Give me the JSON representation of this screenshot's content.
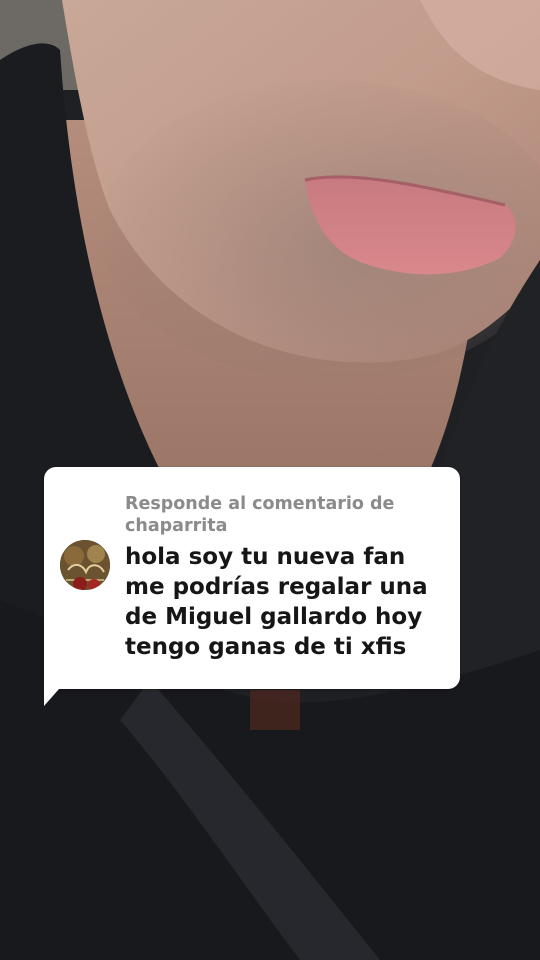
{
  "reply_sticker": {
    "header_lines": [
      "Responde al comentario de",
      "chaparrita"
    ],
    "comment_lines": [
      "hola soy tu nueva fan",
      "me podrías regalar una",
      "de Miguel gallardo hoy",
      "tengo ganas de ti xfis"
    ]
  },
  "colors": {
    "sticker_background": "#ffffff",
    "header_text": "#8b8b8b",
    "comment_text": "#161616"
  }
}
